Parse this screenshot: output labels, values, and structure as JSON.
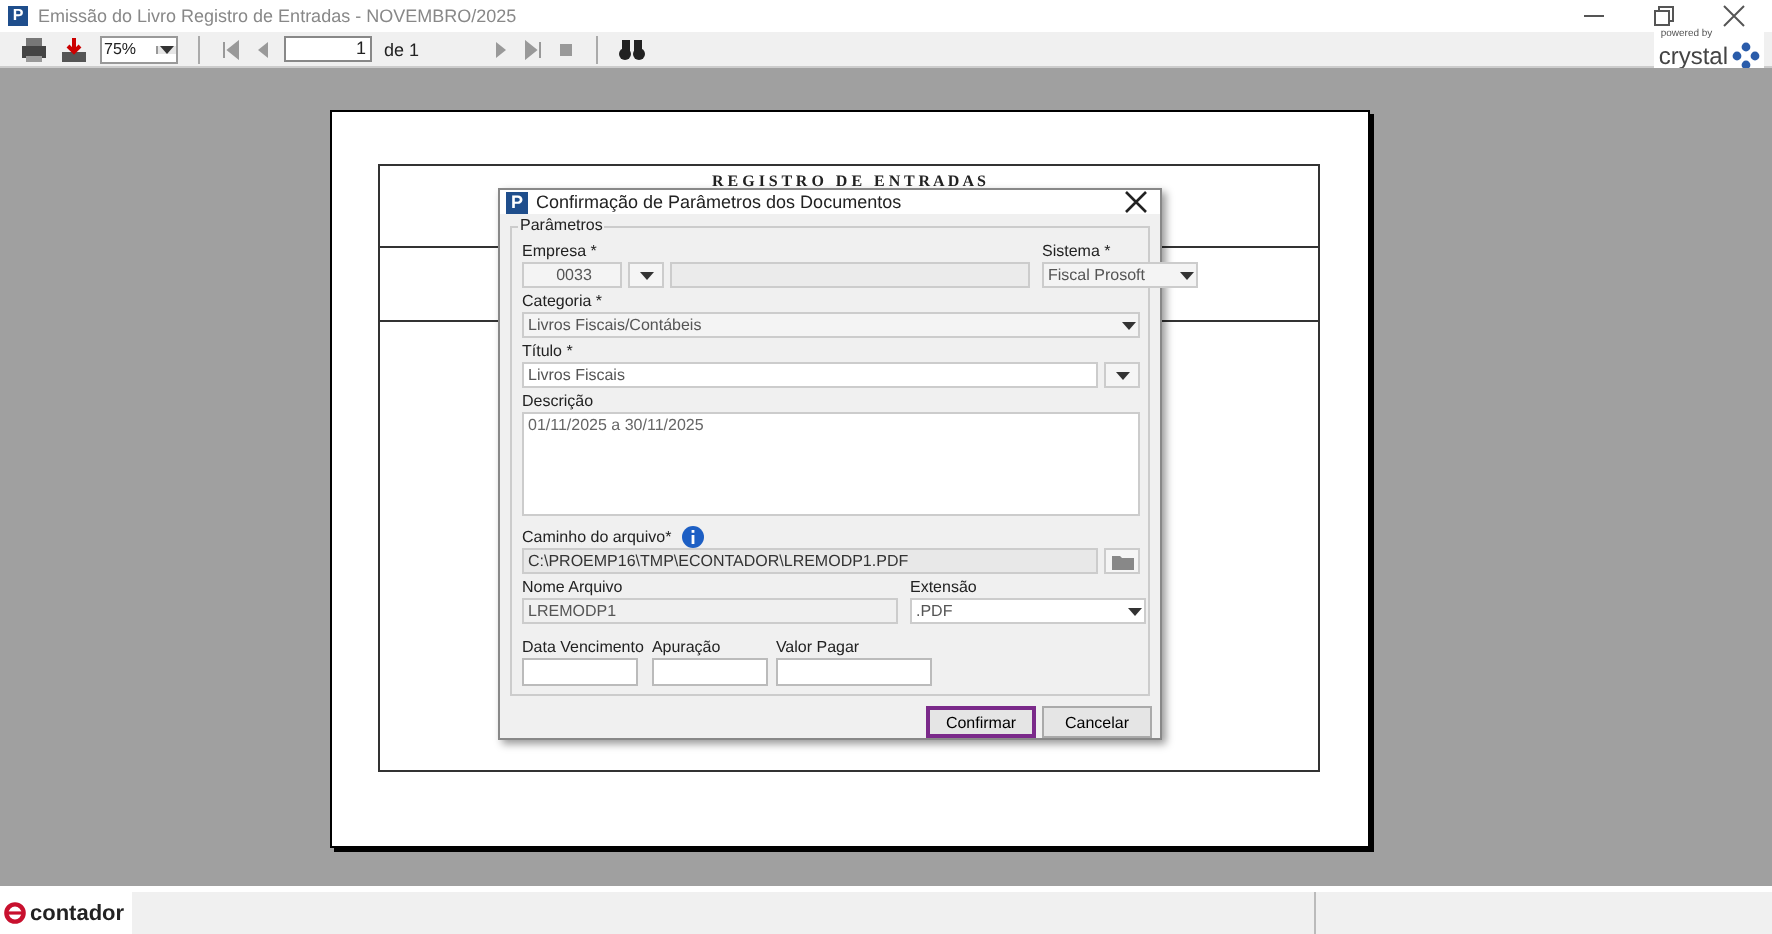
{
  "window": {
    "title": "Emissão do Livro Registro de Entradas - NOVEMBRO/2025",
    "icon_letter": "P"
  },
  "toolbar": {
    "zoom": "75%",
    "page": "1",
    "page_of": "de 1"
  },
  "brand": {
    "powered": "powered by",
    "name": "crystal"
  },
  "report": {
    "title": "R E G I S T R O   D E   E N T R A D A S"
  },
  "dialog": {
    "title": "Confirmação de Parâmetros dos Documentos",
    "icon_letter": "P",
    "group": "Parâmetros",
    "empresa": {
      "label": "Empresa *",
      "value": "0033"
    },
    "sistema": {
      "label": "Sistema *",
      "value": "Fiscal Prosoft"
    },
    "categoria": {
      "label": "Categoria *",
      "value": "Livros Fiscais/Contábeis"
    },
    "titulo": {
      "label": "Título *",
      "value": "Livros Fiscais"
    },
    "descricao": {
      "label": "Descrição",
      "value": "01/11/2025 a 30/11/2025"
    },
    "caminho": {
      "label": "Caminho do arquivo*",
      "value": "C:\\PROEMP16\\TMP\\ECONTADOR\\LREMODP1.PDF"
    },
    "nome": {
      "label": "Nome Arquivo",
      "value": "LREMODP1"
    },
    "extensao": {
      "label": "Extensão",
      "value": ".PDF"
    },
    "small_fields": [
      {
        "label": "Data Vencimento"
      },
      {
        "label": "Apuração"
      },
      {
        "label": "Valor Pagar"
      }
    ],
    "buttons": [
      {
        "label": "Confirmar",
        "focused": true
      },
      {
        "label": "Cancelar",
        "focused": false
      }
    ]
  },
  "status_bar": {
    "logo": "contador"
  }
}
